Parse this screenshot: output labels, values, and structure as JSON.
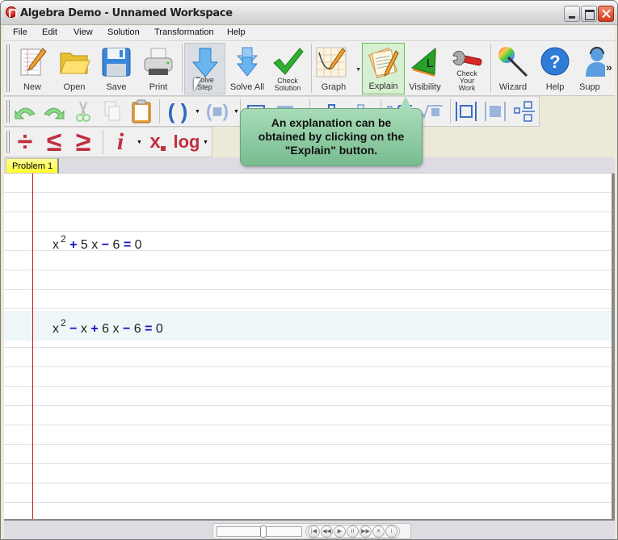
{
  "window": {
    "title": "Algebra Demo - Unnamed Workspace"
  },
  "menu": [
    "File",
    "Edit",
    "View",
    "Solution",
    "Transformation",
    "Help"
  ],
  "toolbar_main": [
    {
      "id": "new",
      "label": "New",
      "icon": "new-document-icon"
    },
    {
      "id": "open",
      "label": "Open",
      "icon": "folder-icon"
    },
    {
      "id": "save",
      "label": "Save",
      "icon": "floppy-disk-icon"
    },
    {
      "id": "print",
      "label": "Print",
      "icon": "printer-icon"
    },
    {
      "id": "solve-step",
      "label": "Solve Step",
      "icon": "down-arrow-icon",
      "state": "pressed"
    },
    {
      "id": "solve-all",
      "label": "Solve All",
      "icon": "double-down-arrow-icon"
    },
    {
      "id": "check-solution",
      "label": "Check Solution",
      "icon": "checkmark-icon"
    },
    {
      "id": "graph",
      "label": "Graph",
      "icon": "graph-icon",
      "dropdown": true
    },
    {
      "id": "explain",
      "label": "Explain",
      "icon": "explain-notepad-icon",
      "state": "active"
    },
    {
      "id": "visibility",
      "label": "Visibility",
      "icon": "visibility-triangle-icon"
    },
    {
      "id": "check-your-work",
      "label": "Check Your Work",
      "icon": "wrench-icon"
    },
    {
      "id": "wizard",
      "label": "Wizard",
      "icon": "magic-wand-icon"
    },
    {
      "id": "help",
      "label": "Help",
      "icon": "question-icon"
    },
    {
      "id": "support",
      "label": "Supp",
      "icon": "support-person-icon"
    }
  ],
  "overflow_chevron": "»",
  "toolbar_edit": {
    "paren_symbol": "( )",
    "box_paren_symbol": "(■)"
  },
  "toolbar_math": {
    "divide": "÷",
    "less_equal": "≤",
    "greater_equal": "≥",
    "imaginary": "i",
    "subscript": "x",
    "log": "log"
  },
  "tooltip": {
    "text": "An explanation can be obtained by clicking on the \"Explain\" button."
  },
  "tabs": [
    {
      "label": "Problem 1",
      "active": true
    }
  ],
  "equations": [
    {
      "base": "x",
      "exp": "2",
      "rest": [
        [
          "op",
          "+"
        ],
        [
          "t",
          "5 x"
        ],
        [
          "op",
          "−"
        ],
        [
          "t",
          "6"
        ],
        [
          "op",
          "="
        ],
        [
          "t",
          "0"
        ]
      ]
    },
    {
      "base": "x",
      "exp": "2",
      "rest": [
        [
          "op",
          "−"
        ],
        [
          "t",
          "x"
        ],
        [
          "op",
          "+"
        ],
        [
          "t",
          "6 x"
        ],
        [
          "op",
          "−"
        ],
        [
          "t",
          "6"
        ],
        [
          "op",
          "="
        ],
        [
          "t",
          "0"
        ]
      ],
      "highlighted": true
    }
  ],
  "player": {
    "slider_position": 0.55,
    "buttons": [
      {
        "name": "first-step-button",
        "glyph": "|◀"
      },
      {
        "name": "previous-step-button",
        "glyph": "◀◀"
      },
      {
        "name": "play-button",
        "glyph": "▶"
      },
      {
        "name": "pause-button",
        "glyph": "II"
      },
      {
        "name": "next-step-button",
        "glyph": "▶▶"
      },
      {
        "name": "stop-button",
        "glyph": "✕"
      },
      {
        "name": "info-button",
        "glyph": "i"
      }
    ]
  }
}
